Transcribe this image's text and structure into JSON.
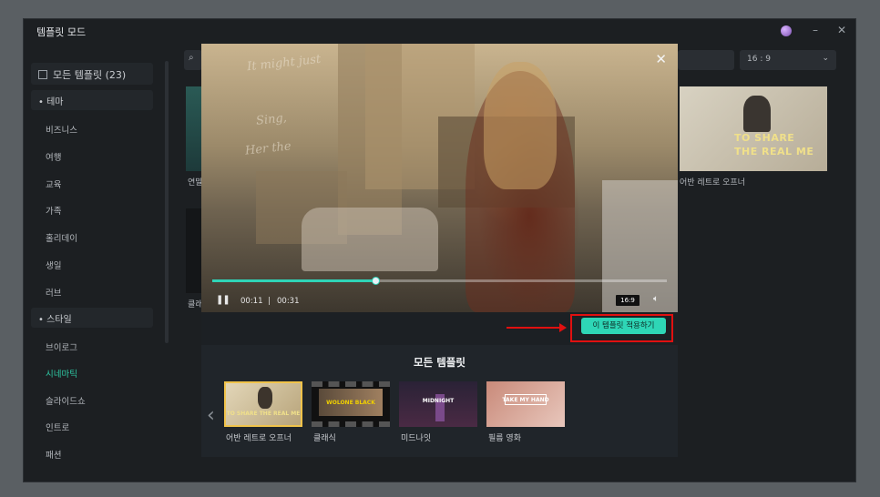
{
  "window": {
    "title": "템플릿 모드",
    "minimize": "–",
    "close": "✕"
  },
  "sidebar": {
    "all": "모든 템플릿 (23)",
    "theme_header": "테마",
    "theme_items": [
      "비즈니스",
      "여행",
      "교육",
      "가족",
      "홀리데이",
      "생일",
      "러브"
    ],
    "style_header": "스타일",
    "style_items": [
      "브이로그",
      "시네마틱",
      "슬라이드쇼",
      "인트로",
      "패션"
    ],
    "active_item": "시네마틱"
  },
  "background": {
    "ratio_select": "16 : 9",
    "right_thumb_text": [
      "TO SHARE",
      "THE REAL ME"
    ],
    "right_thumb_label": "어반 레트로 오프너",
    "left_label_1": "연말",
    "left_label_2": "클래"
  },
  "player": {
    "handwriting": [
      "It might just",
      "Sing,",
      "Her the"
    ],
    "current_time": "00:11",
    "separator": "|",
    "duration": "00:31",
    "progress": 0.36,
    "aspect_badge": "16:9"
  },
  "apply_button": "이 템플릿 적용하기",
  "templates": {
    "title": "모든 템플릿",
    "cards": [
      {
        "label": "어반 레트로 오프너",
        "text": "TO SHARE THE REAL ME"
      },
      {
        "label": "클래식",
        "text": "WOLONE BLACK"
      },
      {
        "label": "미드나잇",
        "text": "MIDNIGHT"
      },
      {
        "label": "필름 영화",
        "text": "TAKE MY HAND"
      }
    ]
  },
  "colors": {
    "accent": "#2ed6b6",
    "highlight": "#e01010",
    "selected_border": "#f0c34a"
  }
}
